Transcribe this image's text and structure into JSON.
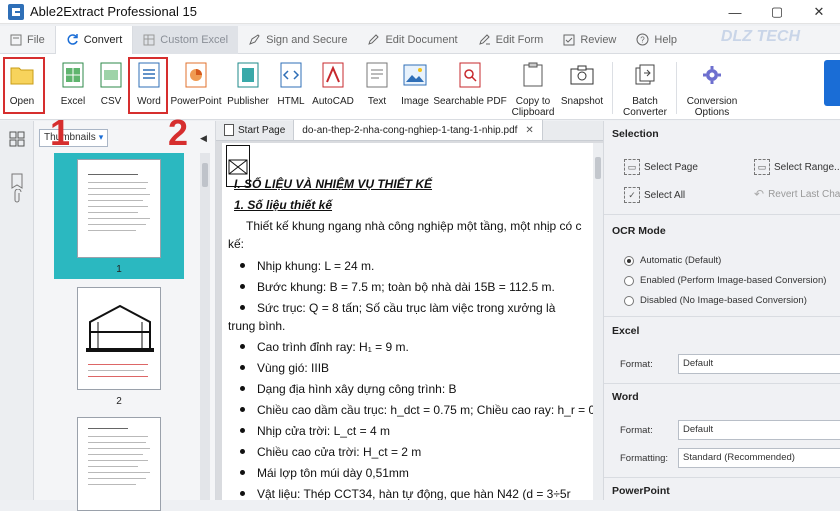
{
  "window": {
    "title": "Able2Extract Professional 15",
    "controls": [
      "—",
      "▢",
      "✕"
    ]
  },
  "menu": {
    "items": [
      {
        "label": "File",
        "state": "normal"
      },
      {
        "label": "Convert",
        "state": "active"
      },
      {
        "label": "Custom Excel",
        "state": "dim"
      },
      {
        "label": "Sign and Secure",
        "state": "normal"
      },
      {
        "label": "Edit Document",
        "state": "normal"
      },
      {
        "label": "Edit Form",
        "state": "normal"
      },
      {
        "label": "Review",
        "state": "normal"
      },
      {
        "label": "Help",
        "state": "normal"
      }
    ],
    "watermark": "DLZ TECH"
  },
  "ribbon": {
    "open": "Open",
    "excel": "Excel",
    "csv": "CSV",
    "word": "Word",
    "powerpoint": "PowerPoint",
    "publisher": "Publisher",
    "html": "HTML",
    "autocad": "AutoCAD",
    "text": "Text",
    "image": "Image",
    "searchable_pdf": "Searchable PDF",
    "copy_clipboard_1": "Copy to",
    "copy_clipboard_2": "Clipboard",
    "snapshot": "Snapshot",
    "batch_1": "Batch",
    "batch_2": "Converter",
    "conv_opts_1": "Conversion",
    "conv_opts_2": "Options"
  },
  "annotations": {
    "step1": "1",
    "step2": "2"
  },
  "thumbnails": {
    "selector_label": "Thumbnails",
    "pages": [
      "1",
      "2"
    ]
  },
  "tabs": {
    "start": "Start Page",
    "doc": "do-an-thep-2-nha-cong-nghiep-1-tang-1-nhip.pdf"
  },
  "document": {
    "heading1": "I. SỐ LIỆU VÀ NHIỆM VỤ THIẾT KẾ",
    "heading2": "1. Số liệu thiết kế",
    "intro1": "Thiết kế khung ngang nhà công nghiệp một tầng, một nhịp có c",
    "intro2": "kế:",
    "bullets": [
      "Nhịp khung: L = 24 m.",
      "Bước khung: B = 7.5 m; toàn bộ nhà dài 15B = 112.5 m.",
      "Sức trục: Q = 8 tấn; Số cầu trục làm việc trong xưởng là",
      "Cao trình đỉnh ray: H₁ = 9 m.",
      "Vùng gió: IIIB",
      "Dạng địa hình xây dựng công trình: B",
      "Chiều cao dầm cầu trục: h_dct = 0.75 m; Chiều cao ray: h_r = 0",
      "Nhịp cửa trời: L_ct = 4 m",
      "Chiều cao cửa trời: H_ct = 2 m",
      "Mái lợp tôn múi dày 0,51mm",
      "Vật liệu: Thép CCT34, hàn tự động, que hàn N42 (d = 3÷5r"
    ],
    "bullet3_cont": "trung bình."
  },
  "panel": {
    "selection": {
      "title": "Selection",
      "select_page": "Select Page",
      "select_range": "Select Range...",
      "select_all": "Select All",
      "revert": "Revert Last Cha"
    },
    "ocr": {
      "title": "OCR Mode",
      "opt1": "Automatic (Default)",
      "opt2": "Enabled (Perform Image-based Conversion)",
      "opt3": "Disabled (No Image-based Conversion)",
      "selected": 1
    },
    "excel": {
      "title": "Excel",
      "format_label": "Format:",
      "format_value": "Default"
    },
    "word": {
      "title": "Word",
      "format_label": "Format:",
      "format_value": "Default",
      "formatting_label": "Formatting:",
      "formatting_value": "Standard (Recommended)"
    },
    "powerpoint": {
      "title": "PowerPoint"
    }
  },
  "colors": {
    "accent": "#1a6dd6",
    "annotation": "#d62e2e",
    "thumb_selected": "#2bb8c0"
  }
}
